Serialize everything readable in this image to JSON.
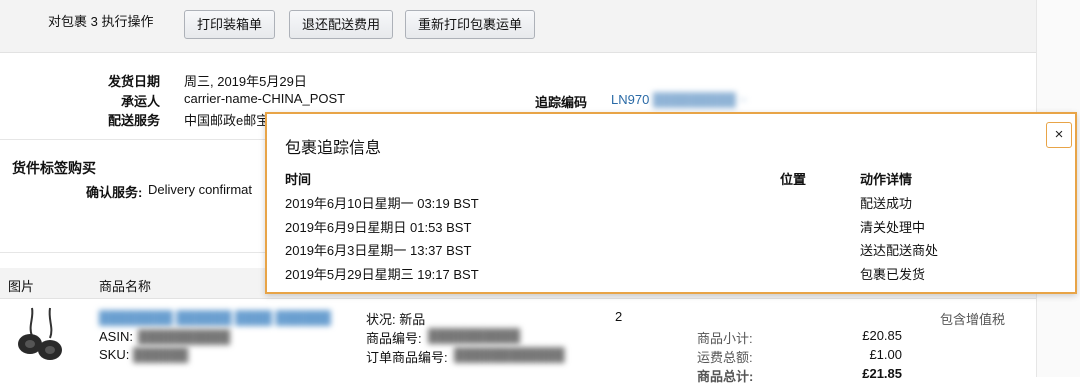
{
  "actions": {
    "label": "对包裹 3 执行操作",
    "buttons": [
      "打印装箱单",
      "退还配送费用",
      "重新打印包裹运单"
    ]
  },
  "shipment": {
    "ship_date_label": "发货日期",
    "ship_date": "周三, 2019年5月29日",
    "carrier_label": "承运人",
    "carrier": "carrier-name-CHINA_POST",
    "service_label": "配送服务",
    "service": "中国邮政e邮宝",
    "tracking_label": "追踪编码",
    "tracking_number": "LN970"
  },
  "label_purchase": {
    "title": "货件标签购买",
    "confirm_label": "确认服务:",
    "confirm_value": "Delivery confirmat"
  },
  "table": {
    "col_image": "图片",
    "col_name": "商品名称"
  },
  "product": {
    "asin_label": "ASIN:",
    "sku_label": "SKU:",
    "condition": "状况: 新品",
    "item_no_label": "商品编号:",
    "order_item_no_label": "订单商品编号:",
    "quantity": "2",
    "tax_note": "包含增值税",
    "subtotal_label": "商品小计:",
    "subtotal": "£20.85",
    "shipping_label": "运费总额:",
    "shipping": "£1.00",
    "total_label": "商品总计:",
    "total": "£21.85"
  },
  "tracking_modal": {
    "title": "包裹追踪信息",
    "close_symbol": "×",
    "headers": {
      "time": "时间",
      "location": "位置",
      "detail": "动作详情"
    },
    "events": [
      {
        "time": "2019年6月10日星期一 03:19 BST",
        "detail": "配送成功"
      },
      {
        "time": "2019年6月9日星期日 01:53 BST",
        "detail": "清关处理中"
      },
      {
        "time": "2019年6月3日星期一 13:37 BST",
        "detail": "送达配送商处"
      },
      {
        "time": "2019年5月29日星期三 19:17 BST",
        "detail": "包裹已发货"
      }
    ]
  },
  "colors": {
    "accent_orange": "#e8a447",
    "link_blue": "#2a6aa6"
  }
}
